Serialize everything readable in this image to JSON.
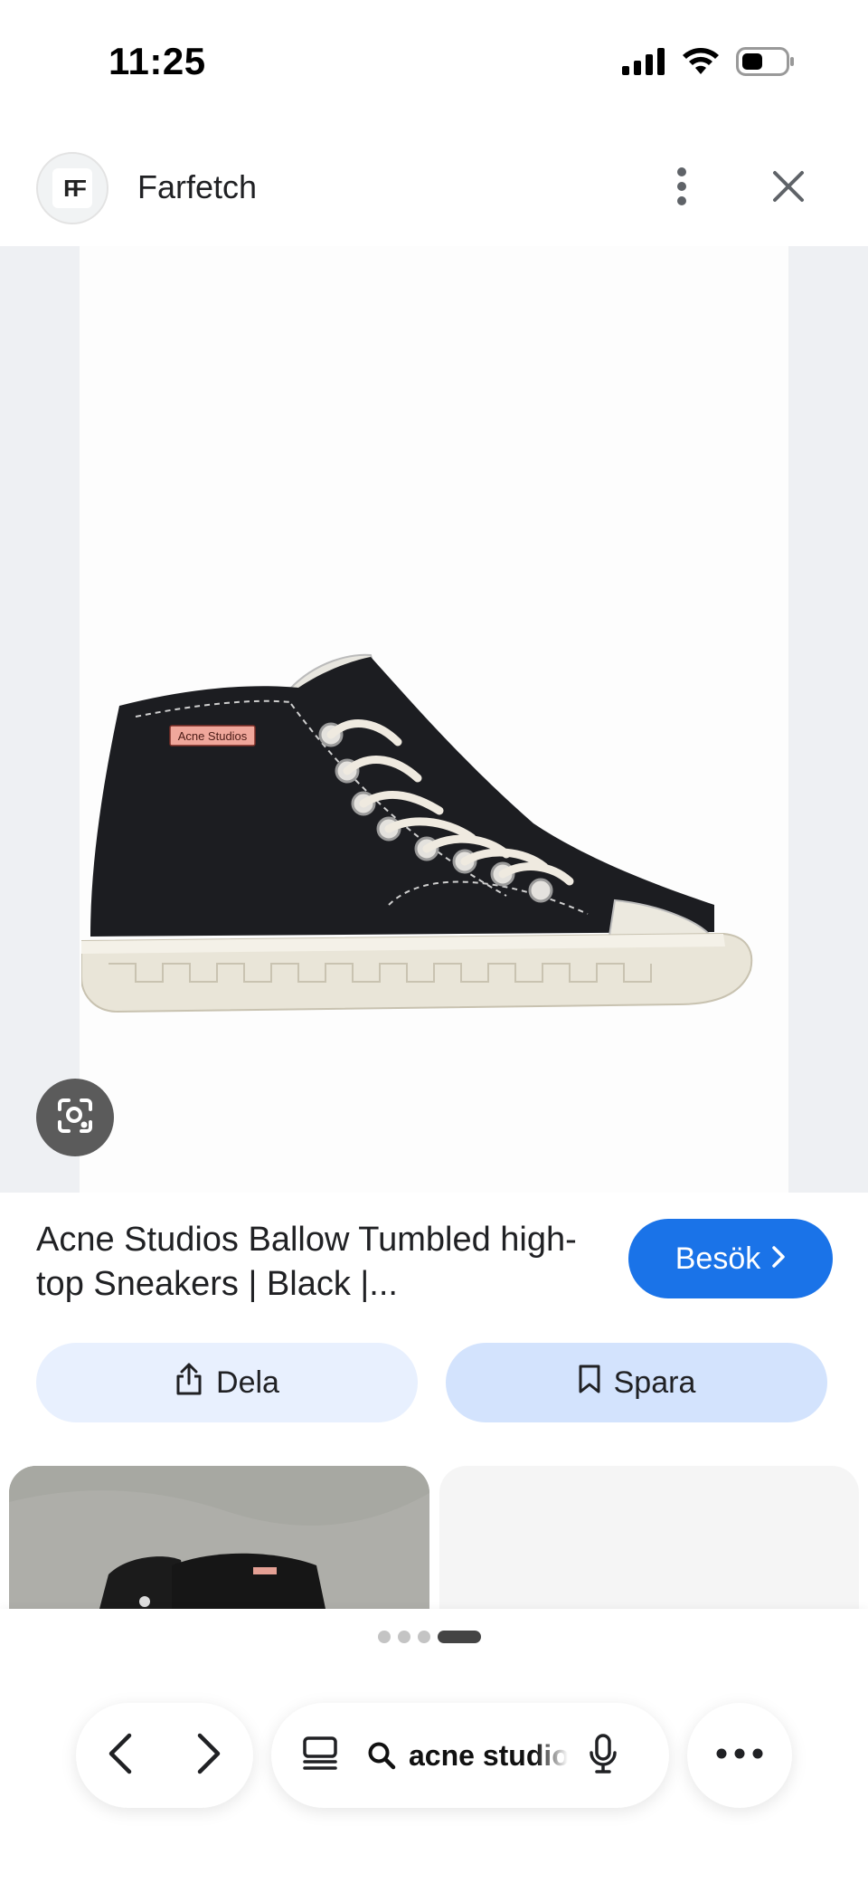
{
  "status_bar": {
    "time": "11:25",
    "icons": [
      "signal-icon",
      "wifi-icon",
      "battery-icon"
    ]
  },
  "header": {
    "site_logo_text": "FF",
    "site_name": "Farfetch",
    "icons": [
      "more-vert-icon",
      "close-icon"
    ]
  },
  "image": {
    "brand_label": "Acne Studios",
    "lens_icon": "lens-icon"
  },
  "result": {
    "title": "Acne Studios Ballow Tumbled high-top Sneakers | Black |...",
    "visit_label": "Besök",
    "visit_icon": "chevron-right-icon"
  },
  "actions": {
    "share_label": "Dela",
    "share_icon": "share-icon",
    "save_label": "Spara",
    "save_icon": "bookmark-icon"
  },
  "pager": {
    "count": 4,
    "active_index": 3
  },
  "bottom_bar": {
    "back_icon": "chevron-left-icon",
    "forward_icon": "chevron-right-icon",
    "tabs_icon": "tabs-icon",
    "search_icon": "search-icon",
    "search_query": "acne studios",
    "mic_icon": "mic-icon",
    "more_icon": "more-horiz-icon"
  },
  "colors": {
    "accent": "#1a73e8",
    "share_bg": "#e8f0fe",
    "save_bg": "#d3e3fd",
    "image_bg": "#eef0f3"
  }
}
